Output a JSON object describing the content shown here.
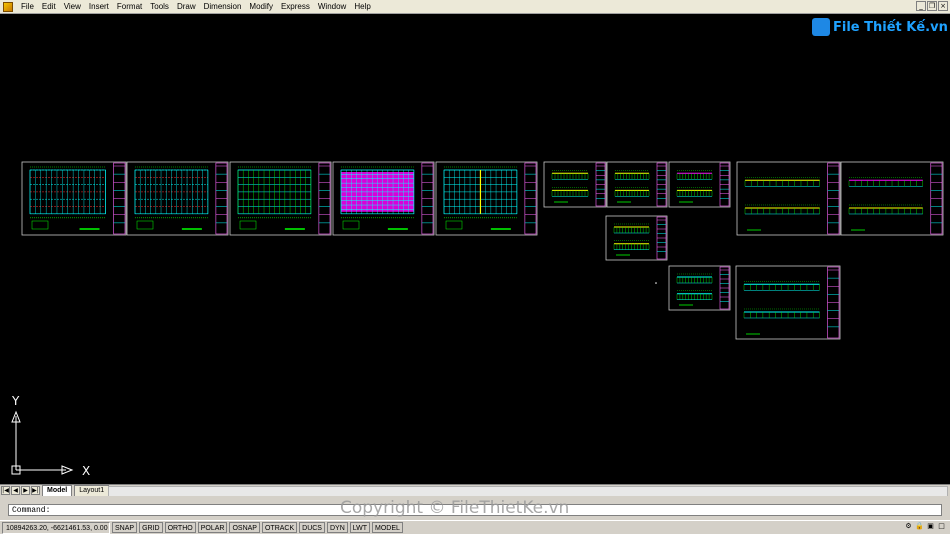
{
  "menu": {
    "items": [
      "File",
      "Edit",
      "View",
      "Insert",
      "Format",
      "Tools",
      "Draw",
      "Dimension",
      "Modify",
      "Express",
      "Window",
      "Help"
    ]
  },
  "logo": {
    "text": "File Thiết Kế.vn"
  },
  "canvas": {
    "axis_x": "X",
    "axis_y": "Y",
    "colors": {
      "background": "#000000",
      "frame": "#ffffff",
      "cyan": "#00ffff",
      "green": "#00ff00",
      "magenta": "#ff00ff",
      "red": "#ff3030",
      "yellow": "#ffff00"
    }
  },
  "tabs": {
    "model": "Model",
    "layout1": "Layout1"
  },
  "command": {
    "prompt": "Command:"
  },
  "watermark": "Copyright © FileThietKe.vn",
  "status": {
    "coords": "10894263.20, -6621461.53, 0.00",
    "toggles": [
      "SNAP",
      "GRID",
      "ORTHO",
      "POLAR",
      "OSNAP",
      "OTRACK",
      "DUCS",
      "DYN",
      "LWT",
      "MODEL"
    ]
  }
}
